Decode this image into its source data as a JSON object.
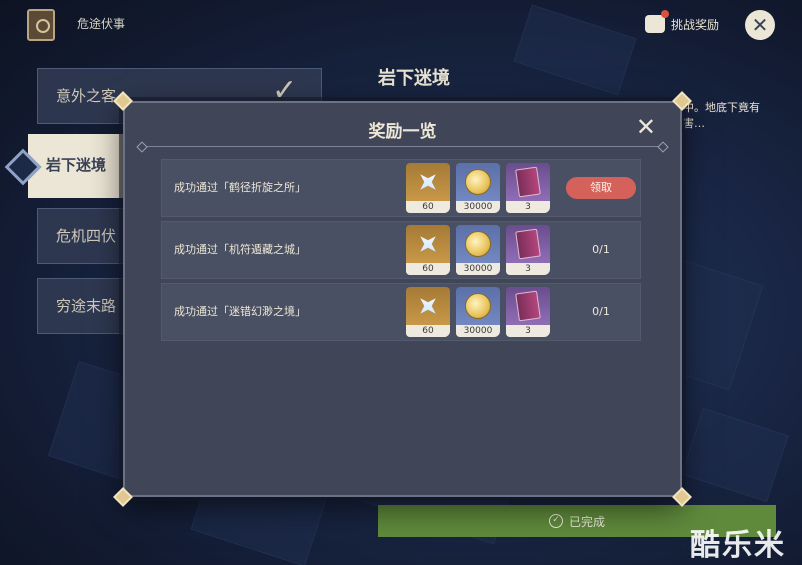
{
  "header": {
    "event_title": "危途伏事",
    "challenge_rewards_label": "挑战奖励",
    "close_symbol": "✕"
  },
  "stages": {
    "tabs": [
      {
        "label": "意外之客"
      },
      {
        "label": "岩下迷境",
        "active": true
      },
      {
        "label": "危机四伏"
      },
      {
        "label": "穷途末路"
      }
    ],
    "title": "岩下迷境",
    "description": "中。地底下竟有\n害…",
    "check_symbol": "✓"
  },
  "completed_label": "已完成",
  "watermark": "酷乐米",
  "modal": {
    "title": "奖励一览",
    "close_symbol": "✕",
    "rows": [
      {
        "label": "成功通过「鹤径折旋之所」",
        "items": [
          {
            "icon": "primogem-icon",
            "qty": "60"
          },
          {
            "icon": "mora-coin-icon",
            "qty": "30000"
          },
          {
            "icon": "hero-wit-book-icon",
            "qty": "3"
          }
        ],
        "action": {
          "type": "claim",
          "label": "领取"
        }
      },
      {
        "label": "成功通过「机符遁藏之城」",
        "items": [
          {
            "icon": "primogem-icon",
            "qty": "60"
          },
          {
            "icon": "mora-coin-icon",
            "qty": "30000"
          },
          {
            "icon": "hero-wit-book-icon",
            "qty": "3"
          }
        ],
        "action": {
          "type": "progress",
          "label": "0/1"
        }
      },
      {
        "label": "成功通过「迷错幻渺之境」",
        "items": [
          {
            "icon": "primogem-icon",
            "qty": "60"
          },
          {
            "icon": "mora-coin-icon",
            "qty": "30000"
          },
          {
            "icon": "hero-wit-book-icon",
            "qty": "3"
          }
        ],
        "action": {
          "type": "progress",
          "label": "0/1"
        }
      }
    ]
  },
  "colors": {
    "claim_button": "#d4615a",
    "completed_bar": "#5f8a3c",
    "modal_bg": "#404658"
  }
}
